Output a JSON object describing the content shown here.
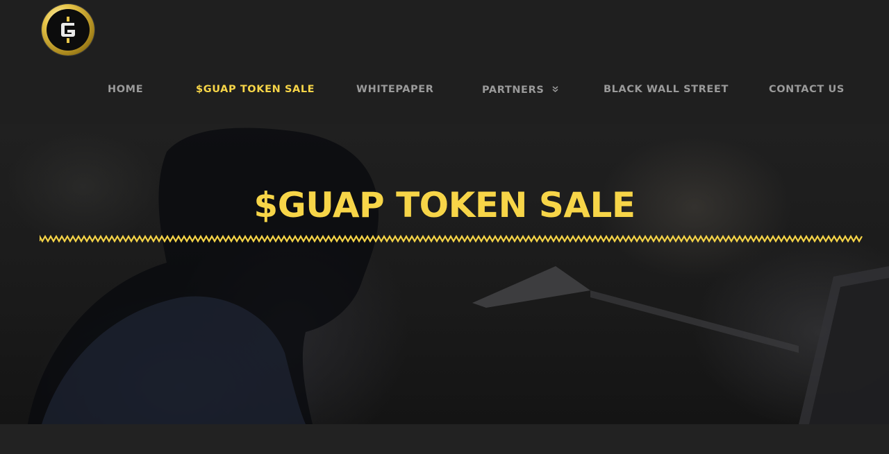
{
  "brand": {
    "logo_icon": "guap-coin-logo-icon",
    "accent_color": "#f7d548"
  },
  "nav": {
    "items": [
      {
        "label": "HOME"
      },
      {
        "label": "$GUAP TOKEN SALE",
        "active": true
      },
      {
        "label": "WHITEPAPER"
      },
      {
        "label": "PARTNERS",
        "icon": "chevron-double-down-icon"
      },
      {
        "label": "BLACK WALL STREET"
      },
      {
        "label": "CONTACT US"
      }
    ]
  },
  "hero": {
    "title": "$GUAP TOKEN SALE",
    "divider_icon": "zigzag-divider"
  }
}
